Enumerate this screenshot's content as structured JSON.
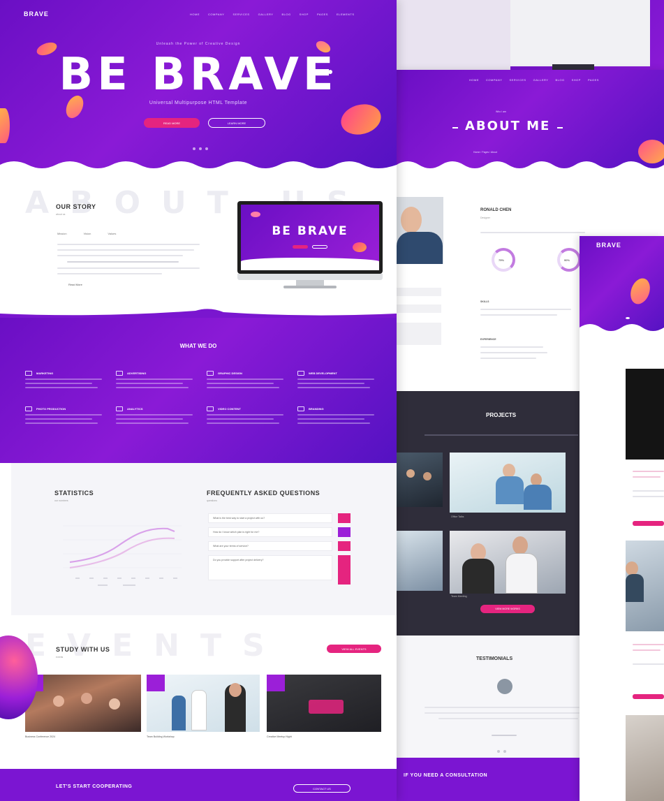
{
  "left_page": {
    "logo": "BRAVE",
    "nav": [
      "Home",
      "Company",
      "Services",
      "Gallery",
      "Blog",
      "Shop",
      "Pages",
      "Elements"
    ],
    "hero": {
      "kicker": "Unleash the Power of Creative Design",
      "title": "BE BRAVE",
      "subtitle": "Universal Multipurpose HTML Template",
      "primary_button": "Read More",
      "secondary_button": "Learn More"
    },
    "about": {
      "watermark": "ABOUT US",
      "title": "OUR STORY",
      "subtitle": "about us",
      "tabs": [
        "Mission",
        "Vision",
        "Values"
      ],
      "read_more": "Read More",
      "monitor_title": "BE BRAVE"
    },
    "services": {
      "title": "WHAT WE DO",
      "items": [
        "Marketing",
        "Advertising",
        "Graphic Design",
        "Web Development",
        "Photo Production",
        "Analytics",
        "Video Content",
        "Branding"
      ]
    },
    "stats": {
      "title": "STATISTICS",
      "subtitle": "our numbers",
      "faq_title": "FREQUENTLY ASKED QUESTIONS",
      "faq_subtitle": "questions",
      "faq": [
        "What is the best way to start a project with us?",
        "How do I know which plan is right for me?",
        "What are your terms of service?",
        "Do you provide support after project delivery?"
      ]
    },
    "events": {
      "watermark": "EVENTS",
      "title": "STUDY WITH US",
      "subtitle": "events",
      "button": "View All Events",
      "captions": [
        "Business Conference 2024",
        "Team Building Workshop",
        "Creative Meetup Night"
      ]
    },
    "cta": {
      "title": "LET'S START COOPERATING",
      "button": "Contact Us"
    }
  },
  "mid_page": {
    "hero_title": "ABOUT ME",
    "hero_kicker": "Who I am",
    "breadcrumb": "Home / Pages / About",
    "profile": {
      "name": "RONALD CHEN",
      "role": "Designer",
      "rings": [
        "75%",
        "90%"
      ],
      "section_labels": [
        "SKILLS",
        "EXPERIENCE"
      ]
    },
    "projects": {
      "title": "PROJECTS",
      "button": "View More Works",
      "captions": [
        "Office Talks",
        "Team Meeting"
      ]
    },
    "testimonials": {
      "title": "TESTIMONIALS"
    },
    "cta": {
      "title": "IF YOU NEED A CONSULTATION"
    }
  },
  "right_page": {
    "logo": "BRAVE"
  },
  "colors": {
    "purple": "#7b15d2",
    "pink": "#e5247f",
    "dark": "#2f2d3a"
  }
}
